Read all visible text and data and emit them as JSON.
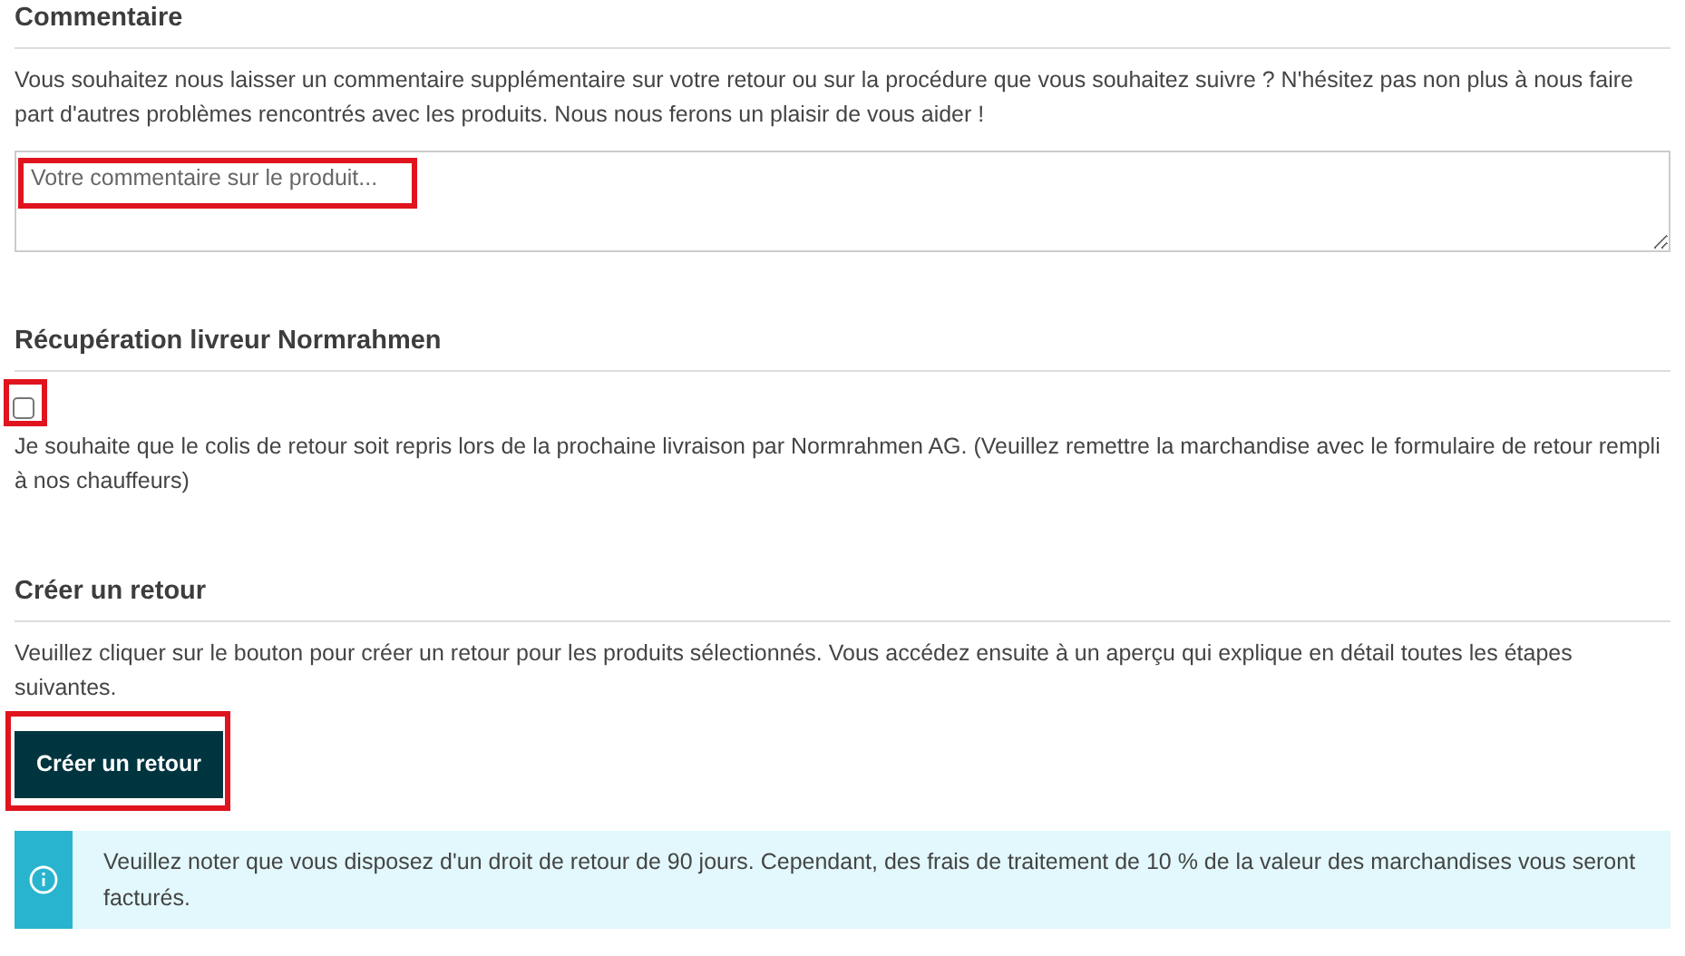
{
  "sections": [
    {
      "kind": "comment",
      "title": "Commentaire",
      "text": "Vous souhaitez nous laisser un commentaire supplémentaire sur votre retour ou sur la procédure que vous souhaitez suivre ? N'hésitez pas non plus à nous faire part d'autres problèmes rencontrés avec les produits. Nous nous ferons un plaisir de vous aider !",
      "field": {
        "placeholder": "Votre commentaire sur le produit...",
        "highlighted": true
      }
    },
    {
      "kind": "pickup",
      "title": "Récupération livreur Normrahmen",
      "checkbox": {
        "checked": false,
        "highlighted": true
      },
      "text": "Je souhaite que le colis de retour soit repris lors de la prochaine livraison par Normrahmen AG. (Veuillez remettre la marchandise avec le formulaire de retour rempli à nos chauffeurs)"
    },
    {
      "kind": "create",
      "title": "Créer un retour",
      "text": "Veuillez cliquer sur le bouton pour créer un retour pour les produits sélectionnés. Vous accédez ensuite à un aperçu qui explique en détail toutes les étapes suivantes.",
      "button": {
        "label": "Créer un retour",
        "highlighted": true
      },
      "notice": "Veuillez noter que vous disposez d'un droit de retour de 90 jours. Cependant, des frais de traitement de 10 % de la valeur des marchandises vous seront facturés."
    }
  ]
}
